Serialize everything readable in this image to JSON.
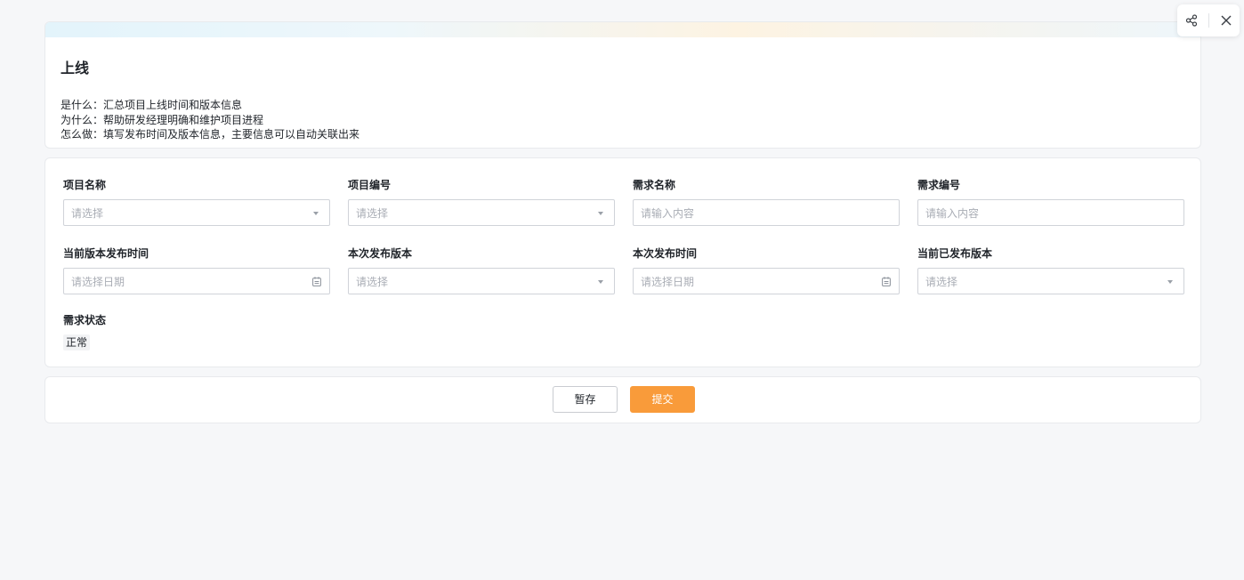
{
  "header": {
    "title": "上线",
    "description": [
      "是什么：汇总项目上线时间和版本信息",
      "为什么：帮助研发经理明确和维护项目进程",
      "怎么做：填写发布时间及版本信息，主要信息可以自动关联出来"
    ]
  },
  "form": {
    "project_name": {
      "label": "项目名称",
      "placeholder": "请选择"
    },
    "project_code": {
      "label": "项目编号",
      "placeholder": "请选择"
    },
    "requirement_name": {
      "label": "需求名称",
      "placeholder": "请输入内容"
    },
    "requirement_code": {
      "label": "需求编号",
      "placeholder": "请输入内容"
    },
    "current_release_time": {
      "label": "当前版本发布时间",
      "placeholder": "请选择日期"
    },
    "this_release_version": {
      "label": "本次发布版本",
      "placeholder": "请选择"
    },
    "this_release_time": {
      "label": "本次发布时间",
      "placeholder": "请选择日期"
    },
    "current_released_version": {
      "label": "当前已发布版本",
      "placeholder": "请选择"
    },
    "requirement_status": {
      "label": "需求状态",
      "value": "正常"
    }
  },
  "actions": {
    "save_label": "暂存",
    "submit_label": "提交"
  },
  "toolbar": {
    "share_icon": "share-icon",
    "close_icon": "close-icon"
  },
  "colors": {
    "accent": "#f99b3a",
    "border": "#d0d3d9",
    "placeholder": "#a9adb5"
  }
}
